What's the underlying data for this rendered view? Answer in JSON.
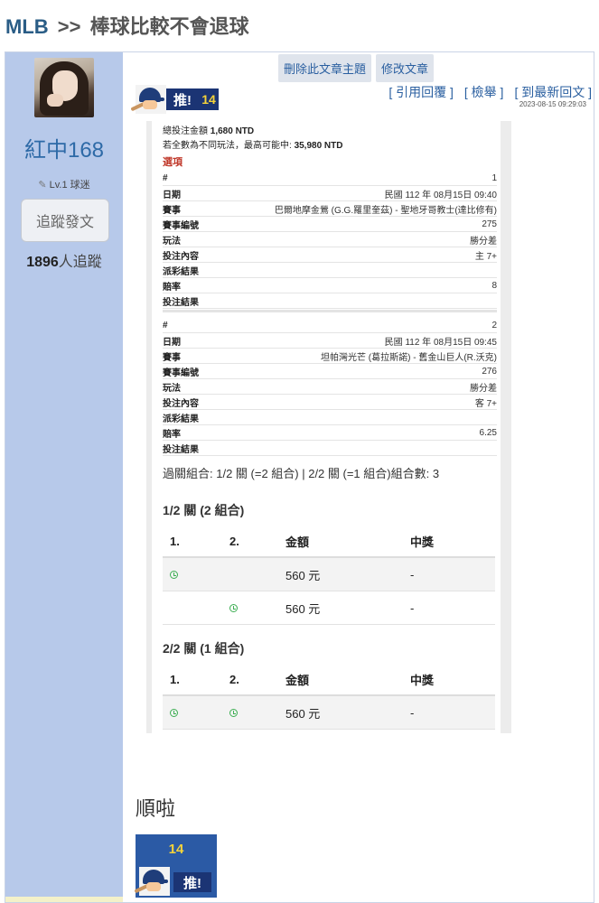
{
  "breadcrumb": {
    "site": "MLB",
    "separator": ">>",
    "board": "棒球比較不會退球"
  },
  "author": {
    "name": "紅中168",
    "level": "Lv.1 球迷",
    "follow_label": "追蹤發文",
    "followers_count": "1896",
    "followers_suffix": "人追蹤"
  },
  "admin": {
    "delete_label": "刪除此文章主題",
    "edit_label": "修改文章"
  },
  "push": {
    "label": "推!",
    "count": "14"
  },
  "actions": {
    "quote": "[ 引用回覆 ]",
    "report": "[ 檢舉 ]",
    "latest": "[ 到最新回文 ]"
  },
  "timestamp": "2023-08-15 09:29:03",
  "bet": {
    "total_label": "總投注金額",
    "total_value": "1,680 NTD",
    "max_label": "若全數為不同玩法，最高可能中:",
    "max_value": "35,980 NTD",
    "options_title": "選項",
    "items": [
      {
        "rows": [
          {
            "k": "#",
            "v": "1"
          },
          {
            "k": "日期",
            "v": "民國 112 年 08月15日 09:40"
          },
          {
            "k": "賽事",
            "v": "巴爾地摩金鶯 (G.G.羅里奎茲) - 聖地牙哥教士(達比修有)"
          },
          {
            "k": "賽事編號",
            "v": "275"
          },
          {
            "k": "玩法",
            "v": "勝分差"
          },
          {
            "k": "投注內容",
            "v": "主 7+"
          },
          {
            "k": "派彩結果",
            "v": ""
          },
          {
            "k": "賠率",
            "v": "8"
          },
          {
            "k": "投注結果",
            "v": ""
          }
        ]
      },
      {
        "rows": [
          {
            "k": "#",
            "v": "2"
          },
          {
            "k": "日期",
            "v": "民國 112 年 08月15日 09:45"
          },
          {
            "k": "賽事",
            "v": "坦帕灣光芒 (葛拉斯諾) - 舊金山巨人(R.沃克)"
          },
          {
            "k": "賽事編號",
            "v": "276"
          },
          {
            "k": "玩法",
            "v": "勝分差"
          },
          {
            "k": "投注內容",
            "v": "客 7+"
          },
          {
            "k": "派彩結果",
            "v": ""
          },
          {
            "k": "賠率",
            "v": "6.25"
          },
          {
            "k": "投注結果",
            "v": ""
          }
        ]
      }
    ],
    "combo_line": "過關組合: 1/2 關 (=2 組合) | 2/2 關 (=1 組合)組合數: 3",
    "sections": [
      {
        "title": "1/2 關 (2 組合)",
        "headers": [
          "1.",
          "2.",
          "金額",
          "中獎"
        ],
        "rows": [
          {
            "amount": "560 元",
            "win": "-"
          },
          {
            "amount": "560 元",
            "win": "-"
          }
        ]
      },
      {
        "title": "2/2 關 (1 組合)",
        "headers": [
          "1.",
          "2.",
          "金額",
          "中獎"
        ],
        "rows": [
          {
            "amount": "560 元",
            "win": "-"
          }
        ]
      }
    ]
  },
  "comment": "順啦",
  "icons": {
    "clock": "clock-icon",
    "pencil": "pencil-icon",
    "mascot": "baseball-mascot-icon"
  },
  "colors": {
    "sidebar": "#b7c9ea",
    "link": "#2a5fa0",
    "push_bg": "#1b3474",
    "push_count": "#f5d33a",
    "options_red": "#c0392b"
  }
}
